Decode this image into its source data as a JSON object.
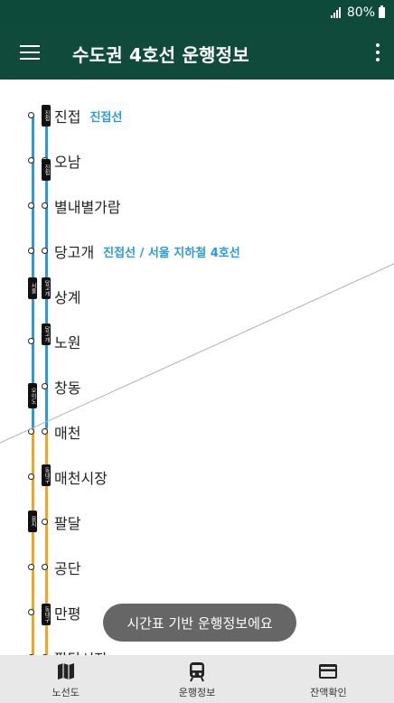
{
  "status_bar": {
    "battery_text": "80%"
  },
  "app_bar": {
    "title": "수도권 4호선 운행정보"
  },
  "stations": [
    {
      "name": "진접",
      "transfer": "진접선"
    },
    {
      "name": "오남",
      "transfer": ""
    },
    {
      "name": "별내별가람",
      "transfer": ""
    },
    {
      "name": "당고개",
      "transfer": "진접선 / 서울 지하철 4호선"
    },
    {
      "name": "상계",
      "transfer": ""
    },
    {
      "name": "노원",
      "transfer": ""
    },
    {
      "name": "창동",
      "transfer": ""
    },
    {
      "name": "매천",
      "transfer": ""
    },
    {
      "name": "매천시장",
      "transfer": ""
    },
    {
      "name": "팔달",
      "transfer": ""
    },
    {
      "name": "공단",
      "transfer": ""
    },
    {
      "name": "만평",
      "transfer": ""
    },
    {
      "name": "팔달시장",
      "transfer": ""
    }
  ],
  "trains": [
    {
      "label": "진접"
    },
    {
      "label": "진접"
    },
    {
      "label": "서울"
    },
    {
      "label": "당고개"
    },
    {
      "label": "당고개"
    },
    {
      "label": "오이도"
    },
    {
      "label": "동대구"
    },
    {
      "label": "용지"
    },
    {
      "label": "동대구"
    }
  ],
  "toast": {
    "text": "시간표 기반 운행정보에요"
  },
  "bottom_nav": {
    "items": [
      {
        "label": "노선도",
        "icon": "map-icon"
      },
      {
        "label": "운행정보",
        "icon": "train-icon"
      },
      {
        "label": "잔액확인",
        "icon": "card-icon"
      }
    ]
  },
  "colors": {
    "app_bar": "#0f4a3b",
    "line_blue": "#2a9ad8",
    "line_orange": "#f0a420",
    "transfer_text": "#2a9ad8"
  }
}
